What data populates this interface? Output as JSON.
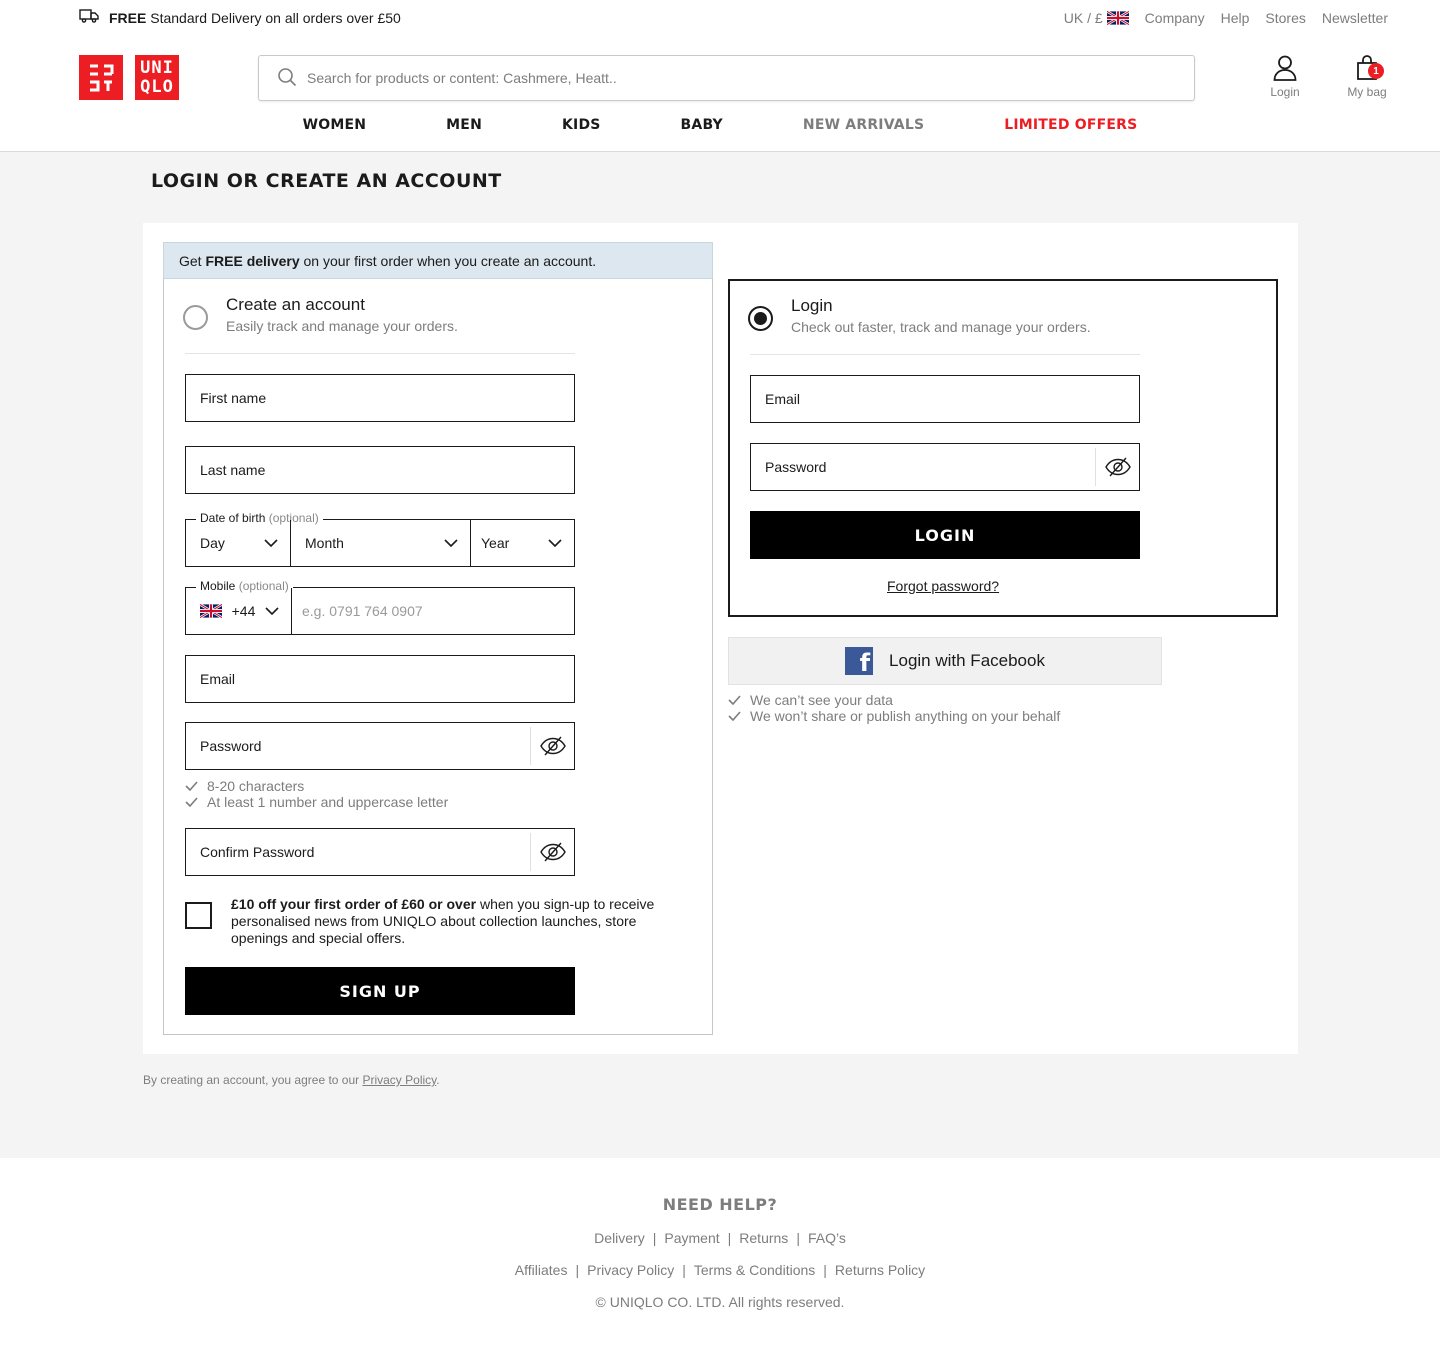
{
  "topbar": {
    "promo_bold": "FREE",
    "promo_text": " Standard Delivery on all orders over £50",
    "locale": "UK / £",
    "links": [
      "Company",
      "Help",
      "Stores",
      "Newsletter"
    ]
  },
  "header": {
    "logo_top": "UNI",
    "logo_bottom": "QLO",
    "search_placeholder": "Search for products or content: Cashmere, Heatt..",
    "login_label": "Login",
    "bag_label": "My bag",
    "bag_count": "1",
    "nav": [
      "WOMEN",
      "MEN",
      "KIDS",
      "BABY",
      "NEW ARRIVALS",
      "LIMITED OFFERS"
    ]
  },
  "page": {
    "title": "LOGIN OR CREATE AN ACCOUNT",
    "banner_pre": "Get ",
    "banner_bold": "FREE delivery",
    "banner_post": " on your first order when you create an account."
  },
  "create": {
    "title": "Create an account",
    "subtitle": "Easily track and manage your orders.",
    "first_name": "First name",
    "last_name": "Last name",
    "dob_label": "Date of birth",
    "optional": "(optional)",
    "day": "Day",
    "month": "Month",
    "year": "Year",
    "mobile_label": "Mobile",
    "dial_code": "+44",
    "mobile_placeholder": "e.g. 0791 764 0907",
    "email": "Email",
    "password": "Password",
    "rules": [
      "8-20 characters",
      "At least 1 number and uppercase letter"
    ],
    "confirm_password": "Confirm Password",
    "optin_bold": "£10 off your first order of £60 or over",
    "optin_text": " when you sign-up to receive personalised news from UNIQLO about collection launches, store openings and special offers.",
    "signup_button": "SIGN UP"
  },
  "login": {
    "title": "Login",
    "subtitle": "Check out faster, track and manage your orders.",
    "email": "Email",
    "password": "Password",
    "login_button": "LOGIN",
    "forgot": "Forgot password?",
    "facebook_button": "Login with Facebook",
    "facebook_notes": [
      "We can’t see your data",
      "We won’t share or publish anything on your behalf"
    ]
  },
  "terms": {
    "pre": "By creating an account, you agree to our ",
    "link": "Privacy Policy",
    "post": "."
  },
  "footer": {
    "heading": "NEED HELP?",
    "row1": [
      "Delivery",
      "Payment",
      "Returns",
      "FAQ’s"
    ],
    "row2": [
      "Affiliates",
      "Privacy Policy",
      "Terms & Conditions",
      "Returns Policy"
    ],
    "copyright": "© UNIQLO CO. LTD. All rights reserved."
  },
  "colors": {
    "brand_red": "#ed1d24",
    "banner_blue": "#dce7ef",
    "facebook_blue": "#3b5998",
    "muted_gray": "#7d7d7d"
  }
}
